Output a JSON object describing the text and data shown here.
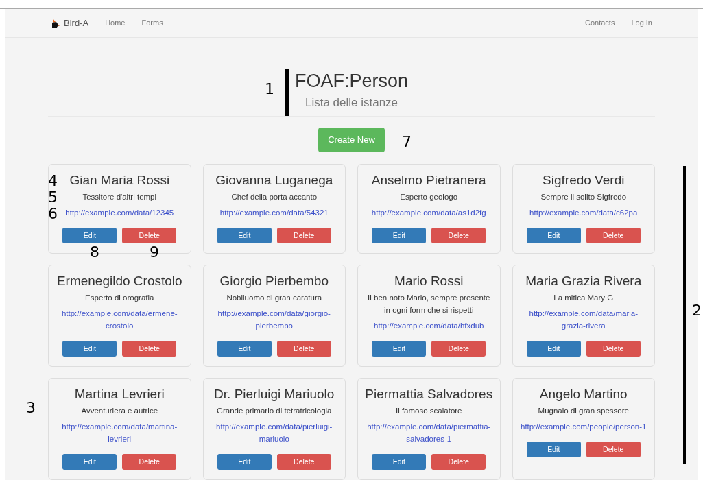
{
  "navbar": {
    "brand": "Bird-A",
    "left_links": [
      "Home",
      "Forms"
    ],
    "right_links": [
      "Contacts",
      "Log In"
    ]
  },
  "header": {
    "title": "FOAF:Person",
    "subtitle": "Lista delle istanze"
  },
  "create_button": "Create New",
  "cards": [
    {
      "name": "Gian Maria Rossi",
      "description": "Tessitore d'altri tempi",
      "url": "http://example.com/data/12345",
      "edit": "Edit",
      "delete": "Delete"
    },
    {
      "name": "Giovanna Luganega",
      "description": "Chef della porta accanto",
      "url": "http://example.com/data/54321",
      "edit": "Edit",
      "delete": "Delete"
    },
    {
      "name": "Anselmo Pietranera",
      "description": "Esperto geologo",
      "url": "http://example.com/data/as1d2fg",
      "edit": "Edit",
      "delete": "Delete"
    },
    {
      "name": "Sigfredo Verdi",
      "description": "Sempre il solito Sigfredo",
      "url": "http://example.com/data/c62pa",
      "edit": "Edit",
      "delete": "Delete"
    },
    {
      "name": "Ermenegildo Crostolo",
      "description": "Esperto di orografia",
      "url": "http://example.com/data/ermene-crostolo",
      "edit": "Edit",
      "delete": "Delete"
    },
    {
      "name": "Giorgio Pierbembo",
      "description": "Nobiluomo di gran caratura",
      "url": "http://example.com/data/giorgio-pierbembo",
      "edit": "Edit",
      "delete": "Delete"
    },
    {
      "name": "Mario Rossi",
      "description": "Il ben noto Mario, sempre presente in ogni form che si rispetti",
      "url": "http://example.com/data/hfxdub",
      "edit": "Edit",
      "delete": "Delete"
    },
    {
      "name": "Maria Grazia Rivera",
      "description": "La mitica Mary G",
      "url": "http://example.com/data/maria-grazia-rivera",
      "edit": "Edit",
      "delete": "Delete"
    },
    {
      "name": "Martina Levrieri",
      "description": "Avventuriera e autrice",
      "url": "http://example.com/data/martina-levrieri",
      "edit": "Edit",
      "delete": "Delete"
    },
    {
      "name": "Dr. Pierluigi Mariuolo",
      "description": "Grande primario di tetratricologia",
      "url": "http://example.com/data/pierluigi-mariuolo",
      "edit": "Edit",
      "delete": "Delete"
    },
    {
      "name": "Piermattia Salvadores",
      "description": "Il famoso scalatore",
      "url": "http://example.com/data/piermattia-salvadores-1",
      "edit": "Edit",
      "delete": "Delete"
    },
    {
      "name": "Angelo Martino",
      "description": "Mugnaio di gran spessore",
      "url": "http://example.com/people/person-1",
      "edit": "Edit",
      "delete": "Delete"
    }
  ],
  "annotations": [
    {
      "label": "1"
    },
    {
      "label": "2"
    },
    {
      "label": "3"
    },
    {
      "label": "4"
    },
    {
      "label": "5"
    },
    {
      "label": "6"
    },
    {
      "label": "7"
    },
    {
      "label": "8"
    },
    {
      "label": "9"
    }
  ]
}
